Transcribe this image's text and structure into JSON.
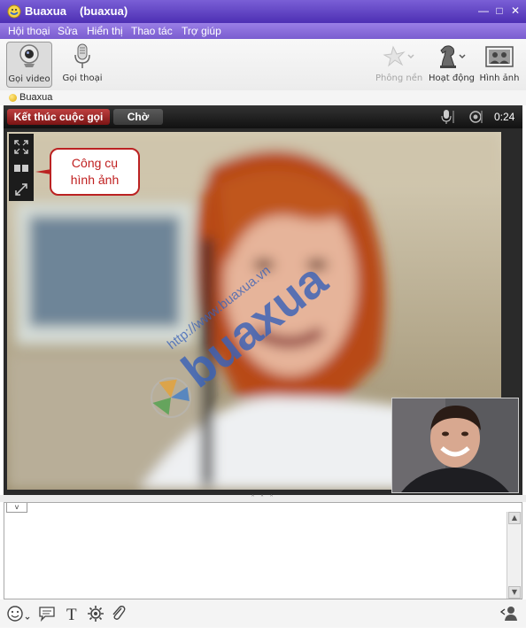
{
  "window": {
    "title": "Buaxua",
    "subtitle": "(buaxua)",
    "controls": [
      "—",
      "□",
      "✕"
    ]
  },
  "menu": [
    "Hội thoại",
    "Sửa",
    "Hiển thị",
    "Thao tác",
    "Trợ giúp"
  ],
  "toolbar": {
    "video_call": "Gọi video",
    "voice_call": "Gọi thoại",
    "background": "Phông nền",
    "activities": "Hoạt động",
    "photos": "Hình ảnh"
  },
  "contact": {
    "name": "Buaxua"
  },
  "call": {
    "end_label": "Kết thúc cuộc gọi",
    "hold_label": "Chờ",
    "timer": "0:24"
  },
  "annotation": {
    "line1": "Công cụ",
    "line2": "hình ảnh"
  },
  "watermark": {
    "url": "http://www.buaxua.vn",
    "brand": "buaxua"
  },
  "splitter_dots": "˄ ˄ ˄",
  "colors": {
    "title_bar": "#5a3cc4",
    "menu_bar": "#8a6cdb",
    "end_call": "#a02828",
    "callout_border": "#b22222"
  }
}
